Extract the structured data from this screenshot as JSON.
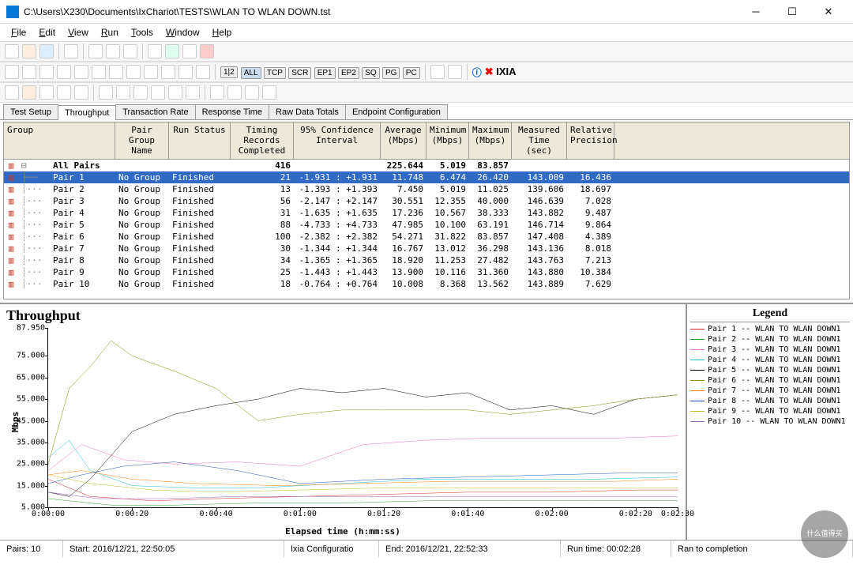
{
  "window": {
    "title": "C:\\Users\\X230\\Documents\\IxChariot\\TESTS\\WLAN TO WLAN DOWN.tst"
  },
  "menu": {
    "items": [
      "File",
      "Edit",
      "View",
      "Run",
      "Tools",
      "Window",
      "Help"
    ]
  },
  "filter_pills": [
    "ALL",
    "TCP",
    "SCR",
    "EP1",
    "EP2",
    "SQ",
    "PG",
    "PC"
  ],
  "brand": "IXIA",
  "tabs": [
    "Test Setup",
    "Throughput",
    "Transaction Rate",
    "Response Time",
    "Raw Data Totals",
    "Endpoint Configuration"
  ],
  "active_tab": "Throughput",
  "grid": {
    "headers": {
      "group": "Group",
      "pair_group": "Pair Group\nName",
      "run_status": "Run Status",
      "timing": "Timing Records\nCompleted",
      "ci": "95% Confidence\nInterval",
      "avg": "Average\n(Mbps)",
      "min": "Minimum\n(Mbps)",
      "max": "Maximum\n(Mbps)",
      "mt": "Measured\nTime (sec)",
      "rp": "Relative\nPrecision"
    },
    "summary": {
      "label": "All Pairs",
      "timing": "416",
      "avg": "225.644",
      "min": "5.019",
      "max": "83.857"
    },
    "rows": [
      {
        "pair": "Pair 1",
        "pgn": "No Group",
        "run": "Finished",
        "tr": "21",
        "ci": "-1.931 : +1.931",
        "avg": "11.748",
        "min": "6.474",
        "max": "26.420",
        "mt": "143.009",
        "rp": "16.436"
      },
      {
        "pair": "Pair 2",
        "pgn": "No Group",
        "run": "Finished",
        "tr": "13",
        "ci": "-1.393 : +1.393",
        "avg": "7.450",
        "min": "5.019",
        "max": "11.025",
        "mt": "139.606",
        "rp": "18.697"
      },
      {
        "pair": "Pair 3",
        "pgn": "No Group",
        "run": "Finished",
        "tr": "56",
        "ci": "-2.147 : +2.147",
        "avg": "30.551",
        "min": "12.355",
        "max": "40.000",
        "mt": "146.639",
        "rp": "7.028"
      },
      {
        "pair": "Pair 4",
        "pgn": "No Group",
        "run": "Finished",
        "tr": "31",
        "ci": "-1.635 : +1.635",
        "avg": "17.236",
        "min": "10.567",
        "max": "38.333",
        "mt": "143.882",
        "rp": "9.487"
      },
      {
        "pair": "Pair 5",
        "pgn": "No Group",
        "run": "Finished",
        "tr": "88",
        "ci": "-4.733 : +4.733",
        "avg": "47.985",
        "min": "10.100",
        "max": "63.191",
        "mt": "146.714",
        "rp": "9.864"
      },
      {
        "pair": "Pair 6",
        "pgn": "No Group",
        "run": "Finished",
        "tr": "100",
        "ci": "-2.382 : +2.382",
        "avg": "54.271",
        "min": "31.822",
        "max": "83.857",
        "mt": "147.408",
        "rp": "4.389"
      },
      {
        "pair": "Pair 7",
        "pgn": "No Group",
        "run": "Finished",
        "tr": "30",
        "ci": "-1.344 : +1.344",
        "avg": "16.767",
        "min": "13.012",
        "max": "36.298",
        "mt": "143.136",
        "rp": "8.018"
      },
      {
        "pair": "Pair 8",
        "pgn": "No Group",
        "run": "Finished",
        "tr": "34",
        "ci": "-1.365 : +1.365",
        "avg": "18.920",
        "min": "11.253",
        "max": "27.482",
        "mt": "143.763",
        "rp": "7.213"
      },
      {
        "pair": "Pair 9",
        "pgn": "No Group",
        "run": "Finished",
        "tr": "25",
        "ci": "-1.443 : +1.443",
        "avg": "13.900",
        "min": "10.116",
        "max": "31.360",
        "mt": "143.880",
        "rp": "10.384"
      },
      {
        "pair": "Pair 10",
        "pgn": "No Group",
        "run": "Finished",
        "tr": "18",
        "ci": "-0.764 : +0.764",
        "avg": "10.008",
        "min": "8.368",
        "max": "13.562",
        "mt": "143.889",
        "rp": "7.629"
      }
    ]
  },
  "chart_data": {
    "type": "line",
    "title": "Throughput",
    "ylabel": "Mbps",
    "xlabel": "Elapsed time (h:mm:ss)",
    "ylim": [
      5,
      87.95
    ],
    "yticks": [
      5,
      15,
      25,
      35,
      45,
      55,
      65,
      75,
      87.95
    ],
    "ytick_labels": [
      "5.000",
      "15.000",
      "25.000",
      "35.000",
      "45.000",
      "55.000",
      "65.000",
      "75.000",
      "87.950"
    ],
    "xlim": [
      0,
      150
    ],
    "xticks": [
      0,
      20,
      40,
      60,
      80,
      100,
      120,
      140,
      150
    ],
    "xtick_labels": [
      "0:00:00",
      "0:00:20",
      "0:00:40",
      "0:01:00",
      "0:01:20",
      "0:01:40",
      "0:02:00",
      "0:02:20",
      "0:02:30"
    ],
    "series": [
      {
        "name": "Pair 1",
        "label": "Pair 1 -- WLAN TO WLAN DOWN1",
        "color": "#d62728",
        "x": [
          0,
          10,
          25,
          40,
          60,
          80,
          100,
          120,
          140,
          150
        ],
        "y": [
          18,
          10,
          8,
          9,
          10,
          11,
          12,
          12,
          13,
          13
        ]
      },
      {
        "name": "Pair 2",
        "label": "Pair 2 -- WLAN TO WLAN DOWN1",
        "color": "#2ca02c",
        "x": [
          0,
          15,
          30,
          50,
          70,
          90,
          110,
          130,
          150
        ],
        "y": [
          9,
          6,
          6,
          7,
          7,
          8,
          8,
          8,
          8
        ]
      },
      {
        "name": "Pair 3",
        "label": "Pair 3 -- WLAN TO WLAN DOWN1",
        "color": "#e377c2",
        "x": [
          0,
          8,
          18,
          30,
          45,
          60,
          75,
          90,
          105,
          120,
          135,
          150
        ],
        "y": [
          22,
          34,
          27,
          25,
          26,
          24,
          34,
          36,
          37,
          37,
          37,
          38
        ]
      },
      {
        "name": "Pair 4",
        "label": "Pair 4 -- WLAN TO WLAN DOWN1",
        "color": "#17becf",
        "x": [
          0,
          5,
          10,
          20,
          35,
          50,
          70,
          90,
          110,
          130,
          150
        ],
        "y": [
          28,
          36,
          22,
          15,
          14,
          14,
          16,
          18,
          18,
          18,
          19
        ]
      },
      {
        "name": "Pair 5",
        "label": "Pair 5 -- WLAN TO WLAN DOWN1",
        "color": "#000000",
        "x": [
          0,
          5,
          10,
          20,
          30,
          40,
          50,
          60,
          70,
          80,
          90,
          100,
          110,
          120,
          130,
          140,
          150
        ],
        "y": [
          12,
          10,
          18,
          40,
          48,
          52,
          55,
          60,
          58,
          60,
          56,
          58,
          50,
          52,
          48,
          55,
          57
        ]
      },
      {
        "name": "Pair 6",
        "label": "Pair 6 -- WLAN TO WLAN DOWN1",
        "color": "#8c8c00",
        "x": [
          0,
          5,
          10,
          15,
          20,
          30,
          40,
          50,
          60,
          70,
          80,
          90,
          100,
          110,
          120,
          130,
          140,
          150
        ],
        "y": [
          25,
          60,
          70,
          82,
          75,
          68,
          60,
          45,
          48,
          50,
          50,
          50,
          50,
          48,
          50,
          52,
          55,
          57
        ]
      },
      {
        "name": "Pair 7",
        "label": "Pair 7 -- WLAN TO WLAN DOWN1",
        "color": "#ff7f0e",
        "x": [
          0,
          8,
          20,
          35,
          55,
          75,
          95,
          115,
          135,
          150
        ],
        "y": [
          20,
          22,
          18,
          16,
          15,
          16,
          17,
          17,
          17,
          18
        ]
      },
      {
        "name": "Pair 8",
        "label": "Pair 8 -- WLAN TO WLAN DOWN1",
        "color": "#1f4fb4",
        "x": [
          0,
          8,
          18,
          30,
          45,
          60,
          80,
          100,
          120,
          140,
          150
        ],
        "y": [
          16,
          20,
          24,
          26,
          22,
          16,
          18,
          19,
          20,
          21,
          21
        ]
      },
      {
        "name": "Pair 9",
        "label": "Pair 9 -- WLAN TO WLAN DOWN1",
        "color": "#bcbd22",
        "x": [
          0,
          10,
          25,
          40,
          60,
          80,
          100,
          120,
          140,
          150
        ],
        "y": [
          20,
          16,
          13,
          12,
          13,
          14,
          14,
          14,
          14,
          14
        ]
      },
      {
        "name": "Pair 10",
        "label": "Pair 10 -- WLAN TO WLAN DOWN1",
        "color": "#9467bd",
        "x": [
          0,
          12,
          28,
          45,
          65,
          85,
          105,
          125,
          145,
          150
        ],
        "y": [
          12,
          9,
          9,
          10,
          10,
          10,
          10,
          10,
          10,
          10
        ]
      }
    ],
    "legend_title": "Legend"
  },
  "status": {
    "pairs": "Pairs: 10",
    "start": "Start: 2016/12/21, 22:50:05",
    "config": "Ixia Configuratio",
    "end": "End: 2016/12/21, 22:52:33",
    "runtime": "Run time: 00:02:28",
    "completion": "Ran to completion"
  },
  "watermark": "什么值得买"
}
